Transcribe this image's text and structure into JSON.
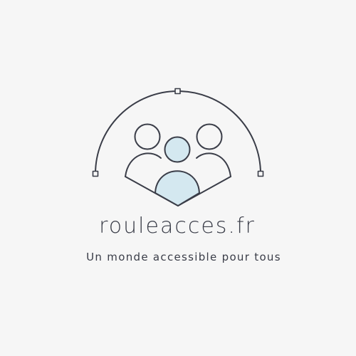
{
  "brand": {
    "name": "rouleacces.fr",
    "tagline": "Un monde accessible pour tous"
  },
  "logo": {
    "icon": "people-group-icon",
    "stroke_color": "#3a3d48",
    "accent_fill": "#d4e8f0",
    "background": "#f6f6f6"
  }
}
